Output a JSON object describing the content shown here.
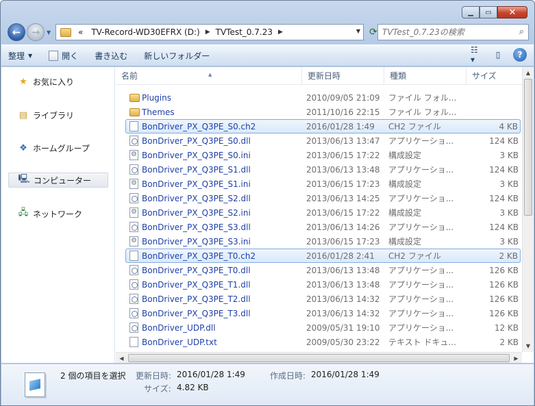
{
  "window": {
    "caption_min": "▁",
    "caption_max": "▭",
    "caption_close": "✕"
  },
  "address": {
    "overflow": "«",
    "crumbs": [
      "TV-Record-WD30EFRX (D:)",
      "TVTest_0.7.23"
    ],
    "search_placeholder": "TVTest_0.7.23の検索"
  },
  "toolbar": {
    "organize": "整理",
    "open": "開く",
    "write": "書き込む",
    "new_folder": "新しいフォルダー"
  },
  "sidebar": {
    "items": [
      {
        "label": "お気に入り",
        "icon": "star-icon"
      },
      {
        "label": "ライブラリ",
        "icon": "library-icon"
      },
      {
        "label": "ホームグループ",
        "icon": "homegroup-icon"
      },
      {
        "label": "コンピューター",
        "icon": "computer-icon"
      },
      {
        "label": "ネットワーク",
        "icon": "network-icon"
      }
    ]
  },
  "columns": {
    "name": "名前",
    "date": "更新日時",
    "type": "種類",
    "size": "サイズ"
  },
  "files": [
    {
      "name": "Plugins",
      "date": "2010/09/05 21:09",
      "type": "ファイル フォル...",
      "size": "",
      "kind": "folder",
      "selected": false
    },
    {
      "name": "Themes",
      "date": "2011/10/16 22:15",
      "type": "ファイル フォル...",
      "size": "",
      "kind": "folder",
      "selected": false
    },
    {
      "name": "BonDriver_PX_Q3PE_S0.ch2",
      "date": "2016/01/28 1:49",
      "type": "CH2 ファイル",
      "size": "4 KB",
      "kind": "file",
      "selected": true
    },
    {
      "name": "BonDriver_PX_Q3PE_S0.dll",
      "date": "2013/06/13 13:47",
      "type": "アプリケーショ...",
      "size": "124 KB",
      "kind": "dll",
      "selected": false
    },
    {
      "name": "BonDriver_PX_Q3PE_S0.ini",
      "date": "2013/06/15 17:22",
      "type": "構成設定",
      "size": "3 KB",
      "kind": "ini",
      "selected": false
    },
    {
      "name": "BonDriver_PX_Q3PE_S1.dll",
      "date": "2013/06/13 13:48",
      "type": "アプリケーショ...",
      "size": "124 KB",
      "kind": "dll",
      "selected": false
    },
    {
      "name": "BonDriver_PX_Q3PE_S1.ini",
      "date": "2013/06/15 17:23",
      "type": "構成設定",
      "size": "3 KB",
      "kind": "ini",
      "selected": false
    },
    {
      "name": "BonDriver_PX_Q3PE_S2.dll",
      "date": "2013/06/13 14:25",
      "type": "アプリケーショ...",
      "size": "124 KB",
      "kind": "dll",
      "selected": false
    },
    {
      "name": "BonDriver_PX_Q3PE_S2.ini",
      "date": "2013/06/15 17:22",
      "type": "構成設定",
      "size": "3 KB",
      "kind": "ini",
      "selected": false
    },
    {
      "name": "BonDriver_PX_Q3PE_S3.dll",
      "date": "2013/06/13 14:26",
      "type": "アプリケーショ...",
      "size": "124 KB",
      "kind": "dll",
      "selected": false
    },
    {
      "name": "BonDriver_PX_Q3PE_S3.ini",
      "date": "2013/06/15 17:23",
      "type": "構成設定",
      "size": "3 KB",
      "kind": "ini",
      "selected": false
    },
    {
      "name": "BonDriver_PX_Q3PE_T0.ch2",
      "date": "2016/01/28 2:41",
      "type": "CH2 ファイル",
      "size": "2 KB",
      "kind": "file",
      "selected": true
    },
    {
      "name": "BonDriver_PX_Q3PE_T0.dll",
      "date": "2013/06/13 13:48",
      "type": "アプリケーショ...",
      "size": "126 KB",
      "kind": "dll",
      "selected": false
    },
    {
      "name": "BonDriver_PX_Q3PE_T1.dll",
      "date": "2013/06/13 13:48",
      "type": "アプリケーショ...",
      "size": "126 KB",
      "kind": "dll",
      "selected": false
    },
    {
      "name": "BonDriver_PX_Q3PE_T2.dll",
      "date": "2013/06/13 14:32",
      "type": "アプリケーショ...",
      "size": "126 KB",
      "kind": "dll",
      "selected": false
    },
    {
      "name": "BonDriver_PX_Q3PE_T3.dll",
      "date": "2013/06/13 14:32",
      "type": "アプリケーショ...",
      "size": "126 KB",
      "kind": "dll",
      "selected": false
    },
    {
      "name": "BonDriver_UDP.dll",
      "date": "2009/05/31 19:10",
      "type": "アプリケーショ...",
      "size": "12 KB",
      "kind": "dll",
      "selected": false
    },
    {
      "name": "BonDriver_UDP.txt",
      "date": "2009/05/30 23:22",
      "type": "テキスト ドキュ...",
      "size": "2 KB",
      "kind": "txt",
      "selected": false
    }
  ],
  "details": {
    "count_text": "2 個の項目を選択",
    "modified_label": "更新日時:",
    "modified_value": "2016/01/28 1:49",
    "created_label": "作成日時:",
    "created_value": "2016/01/28 1:49",
    "size_label": "サイズ:",
    "size_value": "4.82 KB"
  }
}
